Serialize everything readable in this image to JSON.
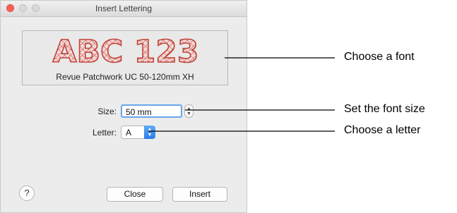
{
  "window": {
    "title": "Insert Lettering"
  },
  "preview": {
    "sample_text": "ABC 123",
    "font_name": "Revue Patchwork UC 50-120mm XH"
  },
  "size": {
    "label": "Size:",
    "value": "50 mm"
  },
  "letter": {
    "label": "Letter:",
    "value": "A"
  },
  "buttons": {
    "help": "?",
    "close": "Close",
    "insert": "Insert"
  },
  "annotations": {
    "font": "Choose a font",
    "size": "Set the font size",
    "letter": "Choose a letter"
  },
  "colors": {
    "stitch": "#c0443b",
    "accent": "#2c7de8",
    "window_bg": "#ececec"
  }
}
